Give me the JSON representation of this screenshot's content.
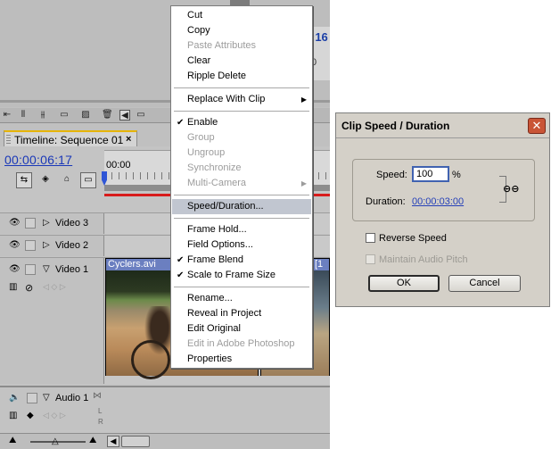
{
  "monitor": {
    "timecode_fragment": ":16",
    "fragment_2": "0"
  },
  "timeline": {
    "tab_title": "Timeline: Sequence 01",
    "tab_close": "×",
    "current_timecode": "00:00:06:17",
    "ruler_start": "00:00",
    "tracks": [
      {
        "label": "Video 3"
      },
      {
        "label": "Video 2"
      },
      {
        "label": "Video 1"
      }
    ],
    "clip_label": "Cyclers.avi",
    "clip2_label": "[1",
    "audio_track": {
      "label": "Audio 1"
    }
  },
  "context_menu": {
    "items": [
      {
        "label": "Cut",
        "enabled": true
      },
      {
        "label": "Copy",
        "enabled": true
      },
      {
        "label": "Paste Attributes",
        "enabled": false
      },
      {
        "label": "Clear",
        "enabled": true
      },
      {
        "label": "Ripple Delete",
        "enabled": true
      },
      {
        "label": "Replace With Clip",
        "enabled": true,
        "submenu": true
      },
      {
        "label": "Enable",
        "enabled": true,
        "checked": true
      },
      {
        "label": "Group",
        "enabled": false
      },
      {
        "label": "Ungroup",
        "enabled": false
      },
      {
        "label": "Synchronize",
        "enabled": false
      },
      {
        "label": "Multi-Camera",
        "enabled": false,
        "submenu": true
      },
      {
        "label": "Speed/Duration...",
        "enabled": true,
        "selected": true
      },
      {
        "label": "Frame Hold...",
        "enabled": true
      },
      {
        "label": "Field Options...",
        "enabled": true
      },
      {
        "label": "Frame Blend",
        "enabled": true,
        "checked": true
      },
      {
        "label": "Scale to Frame Size",
        "enabled": true,
        "checked": true
      },
      {
        "label": "Rename...",
        "enabled": true
      },
      {
        "label": "Reveal in Project",
        "enabled": true
      },
      {
        "label": "Edit Original",
        "enabled": true
      },
      {
        "label": "Edit in Adobe Photoshop",
        "enabled": false
      },
      {
        "label": "Properties",
        "enabled": true
      }
    ]
  },
  "dialog": {
    "title": "Clip Speed / Duration",
    "speed_label": "Speed:",
    "speed_value": "100",
    "speed_unit": "%",
    "duration_label": "Duration:",
    "duration_value": "00:00:03:00",
    "reverse_speed_label": "Reverse Speed",
    "reverse_speed_checked": false,
    "maintain_pitch_label": "Maintain Audio Pitch",
    "maintain_pitch_enabled": false,
    "ok_label": "OK",
    "cancel_label": "Cancel"
  },
  "colors": {
    "timecode_blue": "#1a38b8",
    "menu_highlight": "#c1c6d0",
    "tab_accent": "#e6b400",
    "dialog_bg": "#d4d0c8",
    "close_button": "#c95436"
  }
}
